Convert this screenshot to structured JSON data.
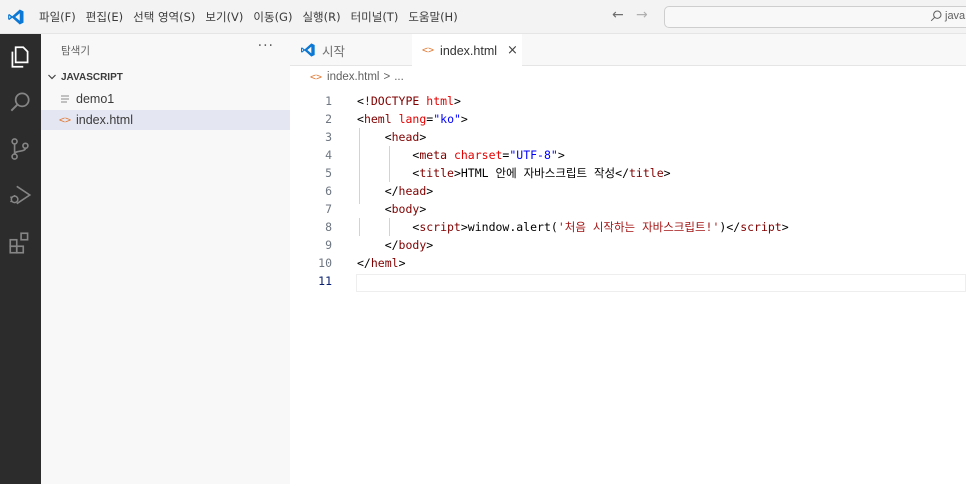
{
  "menu": [
    "파일(F)",
    "편집(E)",
    "선택 영역(S)",
    "보기(V)",
    "이동(G)",
    "실행(R)",
    "터미널(T)",
    "도움말(H)"
  ],
  "search": {
    "text": "java"
  },
  "sidebar": {
    "title": "탐색기",
    "more": "···",
    "section": "JAVASCRIPT",
    "items": [
      {
        "label": "demo1",
        "icon": "file-lines-icon"
      },
      {
        "label": "index.html",
        "icon": "html-file-icon"
      }
    ]
  },
  "tabs": [
    {
      "label": "시작",
      "icon": "vscode-logo-icon"
    },
    {
      "label": "index.html",
      "icon": "html-file-icon",
      "close": "×"
    }
  ],
  "breadcrumb": {
    "file": "index.html",
    "sep": ">",
    "rest": "..."
  },
  "editor": {
    "lines": [
      {
        "n": "1",
        "parts": [
          [
            "t-punc",
            "<"
          ],
          [
            "t-tag",
            "!DOCTYPE"
          ],
          [
            "t-punc",
            " "
          ],
          [
            "t-attr",
            "html"
          ],
          [
            "t-punc",
            ">"
          ]
        ]
      },
      {
        "n": "2",
        "parts": [
          [
            "t-punc",
            "<"
          ],
          [
            "t-tag",
            "heml"
          ],
          [
            "t-punc",
            " "
          ],
          [
            "t-attr",
            "lang"
          ],
          [
            "t-punc",
            "="
          ],
          [
            "t-val",
            "\"ko\""
          ],
          [
            "t-punc",
            ">"
          ]
        ]
      },
      {
        "n": "3",
        "parts": [
          [
            "t-punc",
            "    <"
          ],
          [
            "t-tag",
            "head"
          ],
          [
            "t-punc",
            ">"
          ]
        ]
      },
      {
        "n": "4",
        "parts": [
          [
            "t-punc",
            "        <"
          ],
          [
            "t-tag",
            "meta"
          ],
          [
            "t-punc",
            " "
          ],
          [
            "t-attr",
            "charset"
          ],
          [
            "t-punc",
            "="
          ],
          [
            "t-val",
            "\"UTF-8\""
          ],
          [
            "t-punc",
            ">"
          ]
        ]
      },
      {
        "n": "5",
        "parts": [
          [
            "t-punc",
            "        <"
          ],
          [
            "t-tag",
            "title"
          ],
          [
            "t-punc",
            ">"
          ],
          [
            "t-text",
            "HTML 안에 자바스크립트 작성"
          ],
          [
            "t-punc",
            "</"
          ],
          [
            "t-tag",
            "title"
          ],
          [
            "t-punc",
            ">"
          ]
        ]
      },
      {
        "n": "6",
        "parts": [
          [
            "t-punc",
            "    </"
          ],
          [
            "t-tag",
            "head"
          ],
          [
            "t-punc",
            ">"
          ]
        ]
      },
      {
        "n": "7",
        "parts": [
          [
            "t-punc",
            "    <"
          ],
          [
            "t-tag",
            "body"
          ],
          [
            "t-punc",
            ">"
          ]
        ]
      },
      {
        "n": "8",
        "parts": [
          [
            "t-punc",
            "        <"
          ],
          [
            "t-tag",
            "script"
          ],
          [
            "t-punc",
            ">"
          ],
          [
            "t-text",
            "window.alert("
          ],
          [
            "t-str",
            "'처음 시작하는 자바스크립트!'"
          ],
          [
            "t-text",
            ")"
          ],
          [
            "t-punc",
            "</"
          ],
          [
            "t-tag",
            "script"
          ],
          [
            "t-punc",
            ">"
          ]
        ]
      },
      {
        "n": "9",
        "parts": [
          [
            "t-punc",
            "    </"
          ],
          [
            "t-tag",
            "body"
          ],
          [
            "t-punc",
            ">"
          ]
        ]
      },
      {
        "n": "10",
        "parts": [
          [
            "t-punc",
            "</"
          ],
          [
            "t-tag",
            "heml"
          ],
          [
            "t-punc",
            ">"
          ]
        ]
      },
      {
        "n": "11",
        "parts": []
      }
    ],
    "active_line": "11"
  },
  "colors": {
    "accent": "#0066b8",
    "activitybar": "#2c2c2c",
    "html_icon": "#e37933"
  }
}
